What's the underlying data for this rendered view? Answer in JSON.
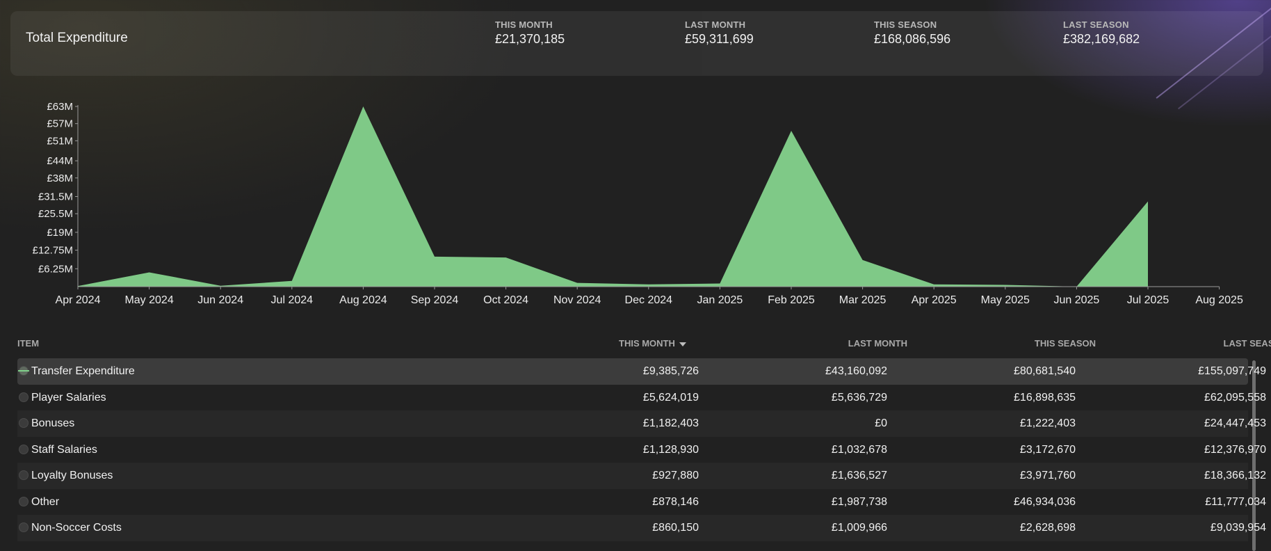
{
  "summary": {
    "title": "Total Expenditure",
    "stats": [
      {
        "label": "THIS MONTH",
        "value": "£21,370,185"
      },
      {
        "label": "LAST MONTH",
        "value": "£59,311,699"
      },
      {
        "label": "THIS SEASON",
        "value": "£168,086,596"
      },
      {
        "label": "LAST SEASON",
        "value": "£382,169,682"
      }
    ]
  },
  "chart_data": {
    "type": "area",
    "x": [
      "Apr 2024",
      "May 2024",
      "Jun 2024",
      "Jul 2024",
      "Aug 2024",
      "Sep 2024",
      "Oct 2024",
      "Nov 2024",
      "Dec 2024",
      "Jan 2025",
      "Feb 2025",
      "Mar 2025",
      "Apr 2025",
      "May 2025",
      "Jun 2025",
      "Jul 2025",
      "Aug 2025"
    ],
    "values": [
      0.2,
      5.0,
      0.3,
      2.0,
      63.0,
      10.5,
      10.2,
      1.3,
      0.8,
      1.1,
      54.5,
      9.3,
      0.8,
      0.6,
      0.0,
      29.8,
      null
    ],
    "yticks": [
      6.25,
      12.75,
      19,
      25.5,
      31.5,
      38,
      44,
      51,
      57,
      63
    ],
    "ytick_labels": [
      "£6.25M",
      "£12.75M",
      "£19M",
      "£25.5M",
      "£31.5M",
      "£38M",
      "£44M",
      "£51M",
      "£57M",
      "£63M"
    ],
    "ylim": [
      0,
      63
    ],
    "fill_color": "#7fc987",
    "grid": false,
    "title": "",
    "xlabel": "",
    "ylabel": ""
  },
  "table": {
    "columns": {
      "item": "ITEM",
      "this_month": "THIS MONTH",
      "last_month": "LAST MONTH",
      "this_season": "THIS SEASON",
      "last_season": "LAST SEASON"
    },
    "rows": [
      {
        "item": "Transfer Expenditure",
        "this_month": "£9,385,726",
        "last_month": "£43,160,092",
        "this_season": "£80,681,540",
        "last_season": "£155,097,749",
        "selected": true
      },
      {
        "item": "Player Salaries",
        "this_month": "£5,624,019",
        "last_month": "£5,636,729",
        "this_season": "£16,898,635",
        "last_season": "£62,095,558"
      },
      {
        "item": "Bonuses",
        "this_month": "£1,182,403",
        "last_month": "£0",
        "this_season": "£1,222,403",
        "last_season": "£24,447,453"
      },
      {
        "item": "Staff Salaries",
        "this_month": "£1,128,930",
        "last_month": "£1,032,678",
        "this_season": "£3,172,670",
        "last_season": "£12,376,970"
      },
      {
        "item": "Loyalty Bonuses",
        "this_month": "£927,880",
        "last_month": "£1,636,527",
        "this_season": "£3,971,760",
        "last_season": "£18,366,132"
      },
      {
        "item": "Other",
        "this_month": "£878,146",
        "last_month": "£1,987,738",
        "this_season": "£46,934,036",
        "last_season": "£11,777,034"
      },
      {
        "item": "Non-Soccer Costs",
        "this_month": "£860,150",
        "last_month": "£1,009,966",
        "this_season": "£2,628,698",
        "last_season": "£9,039,954"
      }
    ]
  }
}
